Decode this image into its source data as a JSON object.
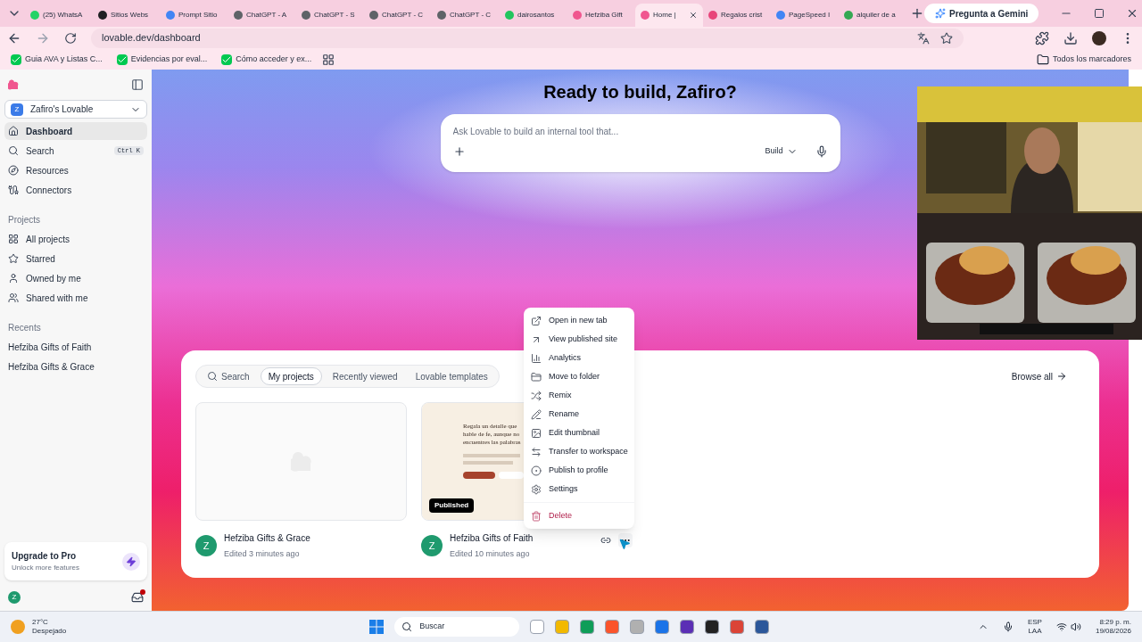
{
  "browser": {
    "tabs": [
      {
        "title": "(25) WhatsA",
        "selected": false,
        "color": "#25d366"
      },
      {
        "title": "Sitios Webs",
        "selected": false,
        "color": "#202124"
      },
      {
        "title": "Prompt Sitio",
        "selected": false,
        "color": "#4285f4"
      },
      {
        "title": "ChatGPT - A",
        "selected": false,
        "color": "#5f6368"
      },
      {
        "title": "ChatGPT - S",
        "selected": false,
        "color": "#5f6368"
      },
      {
        "title": "ChatGPT - C",
        "selected": false,
        "color": "#5f6368"
      },
      {
        "title": "ChatGPT - C",
        "selected": false,
        "color": "#5f6368"
      },
      {
        "title": "dairosantos",
        "selected": false,
        "color": "#22c55e"
      },
      {
        "title": "Hefziba Gift",
        "selected": false,
        "color": "#f0568f"
      },
      {
        "title": "Home | ",
        "selected": true,
        "color": "#f0568f"
      },
      {
        "title": "Regalos crist",
        "selected": false,
        "color": "#e8457a"
      },
      {
        "title": "PageSpeed I",
        "selected": false,
        "color": "#4285f4"
      },
      {
        "title": "alquiler de a",
        "selected": false,
        "color": "#34a853"
      }
    ],
    "gemini": "Pregunta a Gemini",
    "url": "lovable.dev/dashboard",
    "bookmarks": [
      "Guia AVA y Listas C...",
      "Evidencias por eval...",
      "Cómo acceder y ex..."
    ],
    "all_bookmarks": "Todos los marcadores"
  },
  "sidebar": {
    "workspace": {
      "initial": "Z",
      "name": "Zafiro's Lovable"
    },
    "nav": [
      {
        "label": "Dashboard",
        "selected": true
      },
      {
        "label": "Search",
        "selected": false,
        "shortcut": "Ctrl K"
      },
      {
        "label": "Resources",
        "selected": false
      },
      {
        "label": "Connectors",
        "selected": false
      }
    ],
    "projects_heading": "Projects",
    "projects": [
      {
        "label": "All projects"
      },
      {
        "label": "Starred"
      },
      {
        "label": "Owned by me"
      },
      {
        "label": "Shared with me"
      }
    ],
    "recents_heading": "Recents",
    "recents": [
      "Hefziba Gifts of Faith",
      "Hefziba Gifts & Grace"
    ],
    "upgrade": {
      "title": "Upgrade to Pro",
      "subtitle": "Unlock more features"
    },
    "user_initial": "Z"
  },
  "hero": {
    "title": "Ready to build, Zafiro?",
    "prompt": {
      "placeholder": "Ask Lovable to build an internal tool that...",
      "mode": "Build"
    }
  },
  "projects_panel": {
    "filters": [
      {
        "label": "Search",
        "kind": "search",
        "selected": false
      },
      {
        "label": "My projects",
        "kind": "tab",
        "selected": true
      },
      {
        "label": "Recently viewed",
        "kind": "tab",
        "selected": false
      },
      {
        "label": "Lovable templates",
        "kind": "tab",
        "selected": false
      }
    ],
    "browse_all": "Browse all",
    "cards": [
      {
        "title": "Hefziba Gifts & Grace",
        "edited": "Edited 3 minutes ago",
        "initial": "Z",
        "thumbnail": {
          "kind": "blank"
        }
      },
      {
        "title": "Hefziba Gifts of Faith",
        "edited": "Edited 10 minutes ago",
        "initial": "Z",
        "badge": "Published",
        "hovered": true,
        "thumbnail": {
          "kind": "site",
          "heading": "Regala un detalle que hable de fe, aunque no encuentres las palabras"
        }
      }
    ]
  },
  "context_menu": {
    "items": [
      {
        "label": "Open in new tab",
        "kind": "normal"
      },
      {
        "label": "View published site",
        "kind": "normal"
      },
      {
        "label": "Analytics",
        "kind": "normal"
      },
      {
        "label": "Move to folder",
        "kind": "normal"
      },
      {
        "label": "Remix",
        "kind": "normal"
      },
      {
        "label": "Rename",
        "kind": "normal"
      },
      {
        "label": "Edit thumbnail",
        "kind": "normal"
      },
      {
        "label": "Transfer to workspace",
        "kind": "normal"
      },
      {
        "label": "Publish to profile",
        "kind": "normal"
      },
      {
        "label": "Settings",
        "kind": "normal"
      },
      {
        "label": "Delete",
        "kind": "danger"
      }
    ]
  },
  "taskbar": {
    "temperature": "27°C",
    "weather": "Despejado",
    "search": "Buscar",
    "lang": "ESP",
    "layout": "LAA",
    "time": "8:29 p. m.",
    "date": "19/08/2026"
  }
}
